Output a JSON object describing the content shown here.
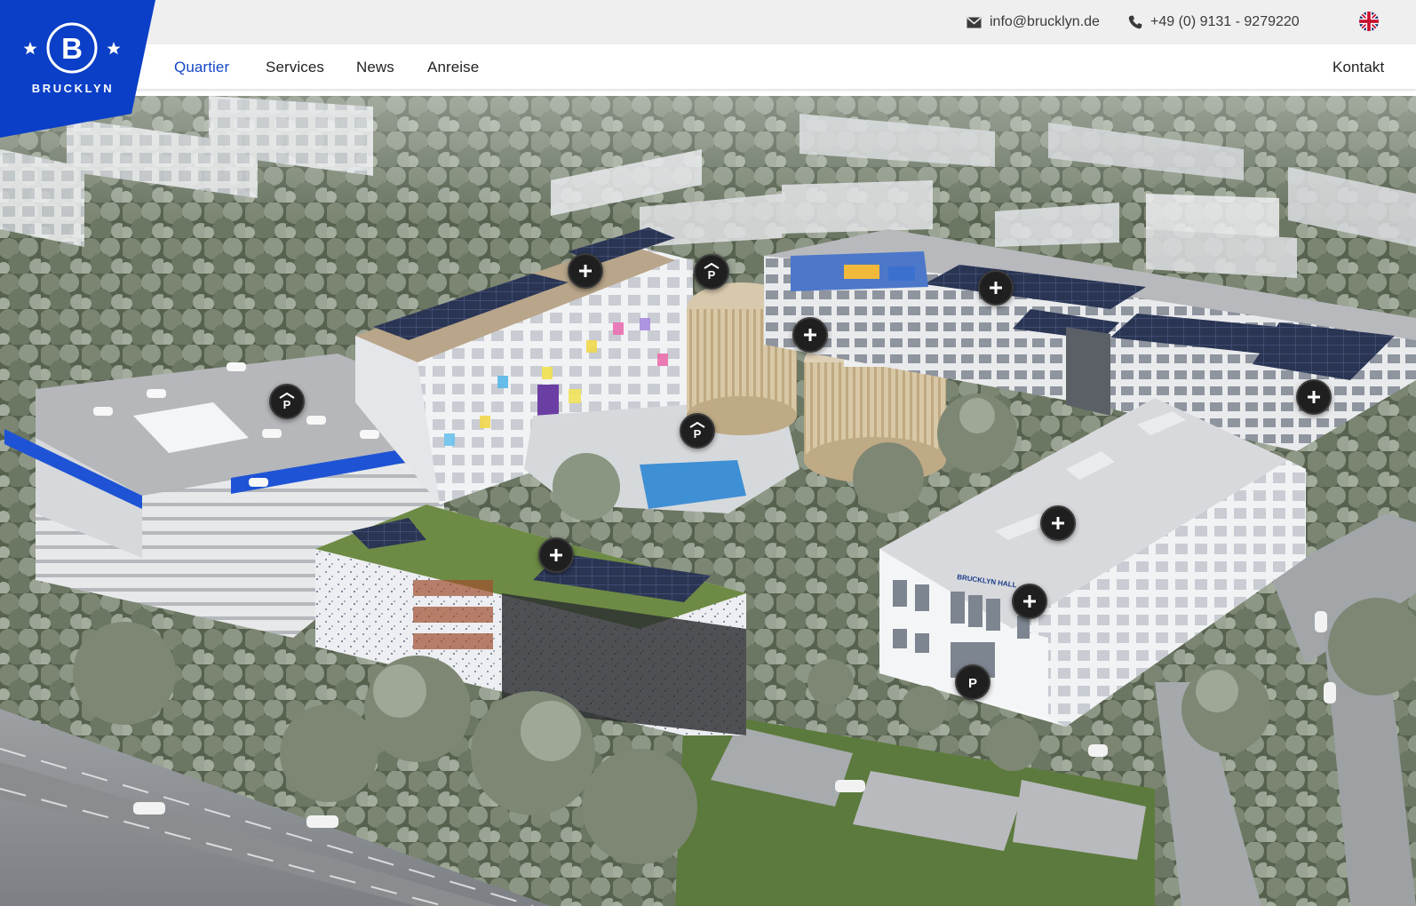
{
  "brand": {
    "name": "BRUCKLYN",
    "letter": "B",
    "color": "#0b3fc7"
  },
  "contact": {
    "email": "info@brucklyn.de",
    "phone": "+49 (0) 9131 - 9279220"
  },
  "language": {
    "icon": "uk-flag-icon"
  },
  "nav": {
    "items": [
      {
        "label": "Quartier",
        "active": true
      },
      {
        "label": "Services",
        "active": false
      },
      {
        "label": "News",
        "active": false
      },
      {
        "label": "Anreise",
        "active": false
      }
    ],
    "contact_label": "Kontakt"
  },
  "map": {
    "building_sign": "BRUCKLYN HALL",
    "hotspots": [
      {
        "kind": "info",
        "icon": "plus-icon"
      },
      {
        "kind": "parking-covered",
        "icon": "parking-garage-icon",
        "label": "P"
      },
      {
        "kind": "info",
        "icon": "plus-icon"
      },
      {
        "kind": "info",
        "icon": "plus-icon"
      },
      {
        "kind": "parking-covered",
        "icon": "parking-garage-icon",
        "label": "P"
      },
      {
        "kind": "parking-covered",
        "icon": "parking-garage-icon",
        "label": "P"
      },
      {
        "kind": "info",
        "icon": "plus-icon"
      },
      {
        "kind": "info",
        "icon": "plus-icon"
      },
      {
        "kind": "info",
        "icon": "plus-icon"
      },
      {
        "kind": "info",
        "icon": "plus-icon"
      },
      {
        "kind": "parking",
        "icon": "parking-icon",
        "label": "P"
      }
    ]
  },
  "colors": {
    "accent": "#1447c7",
    "topbar_bg": "#efefef",
    "hotspot_bg": "#1f1f1f"
  }
}
